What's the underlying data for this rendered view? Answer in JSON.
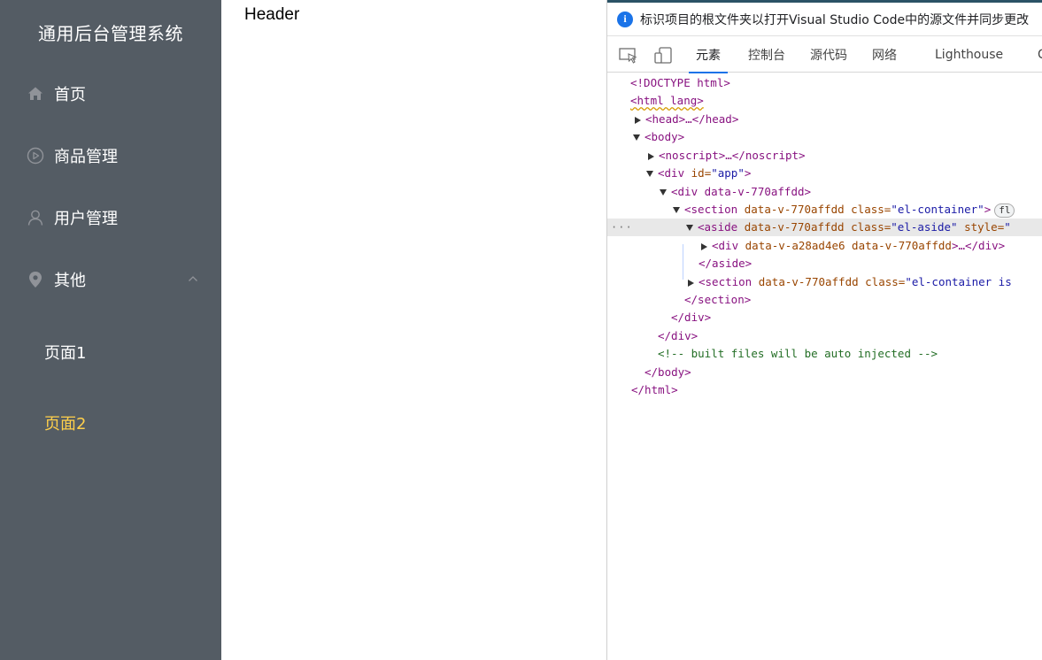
{
  "sidebar": {
    "title": "通用后台管理系统",
    "background": "#545c64",
    "active_text_color": "#ffd04b",
    "items": [
      {
        "label": "首页",
        "icon": "home-icon"
      },
      {
        "label": "商品管理",
        "icon": "video-play-icon"
      },
      {
        "label": "用户管理",
        "icon": "user-icon"
      },
      {
        "label": "其他",
        "icon": "location-icon",
        "expanded": true
      }
    ],
    "submenu": [
      {
        "label": "页面1",
        "active": false
      },
      {
        "label": "页面2",
        "active": true
      }
    ]
  },
  "main": {
    "header": "Header"
  },
  "devtools": {
    "info_bar": "标识项目的根文件夹以打开Visual Studio Code中的源文件并同步更改",
    "tabs": [
      "元素",
      "控制台",
      "源代码",
      "网络",
      "Lighthouse",
      "C"
    ],
    "active_tab": "元素",
    "tree": {
      "doctype": "<!DOCTYPE html>",
      "html_open": "<html lang>",
      "head": "<head>…</head>",
      "body_open": "<body>",
      "noscript": "<noscript>…</noscript>",
      "div_app_tag": "<div",
      "div_app_attr": "id=",
      "div_app_val": "\"app\"",
      "div_inner": "<div data-v-770affdd>",
      "section1_tag": "<section",
      "section1_attr": "data-v-770affdd class=",
      "section1_val": "\"el-container\"",
      "section1_badge": "fl",
      "aside_tag": "<aside",
      "aside_attr": "data-v-770affdd class=",
      "aside_val": "\"el-aside\"",
      "aside_style": "style=",
      "aside_style_val": "\"",
      "aside_child_tag": "<div",
      "aside_child_attr": "data-v-a28ad4e6 data-v-770affdd",
      "aside_child_end": ">…</div>",
      "aside_close": "</aside>",
      "section2_tag": "<section",
      "section2_attr": "data-v-770affdd class=",
      "section2_val": "\"el-container is",
      "section_close": "</section>",
      "div_close_1": "</div>",
      "div_close_2": "</div>",
      "comment": "<!-- built files will be auto injected -->",
      "body_close": "</body>",
      "html_close": "</html>",
      "selected_marker": "···"
    }
  }
}
